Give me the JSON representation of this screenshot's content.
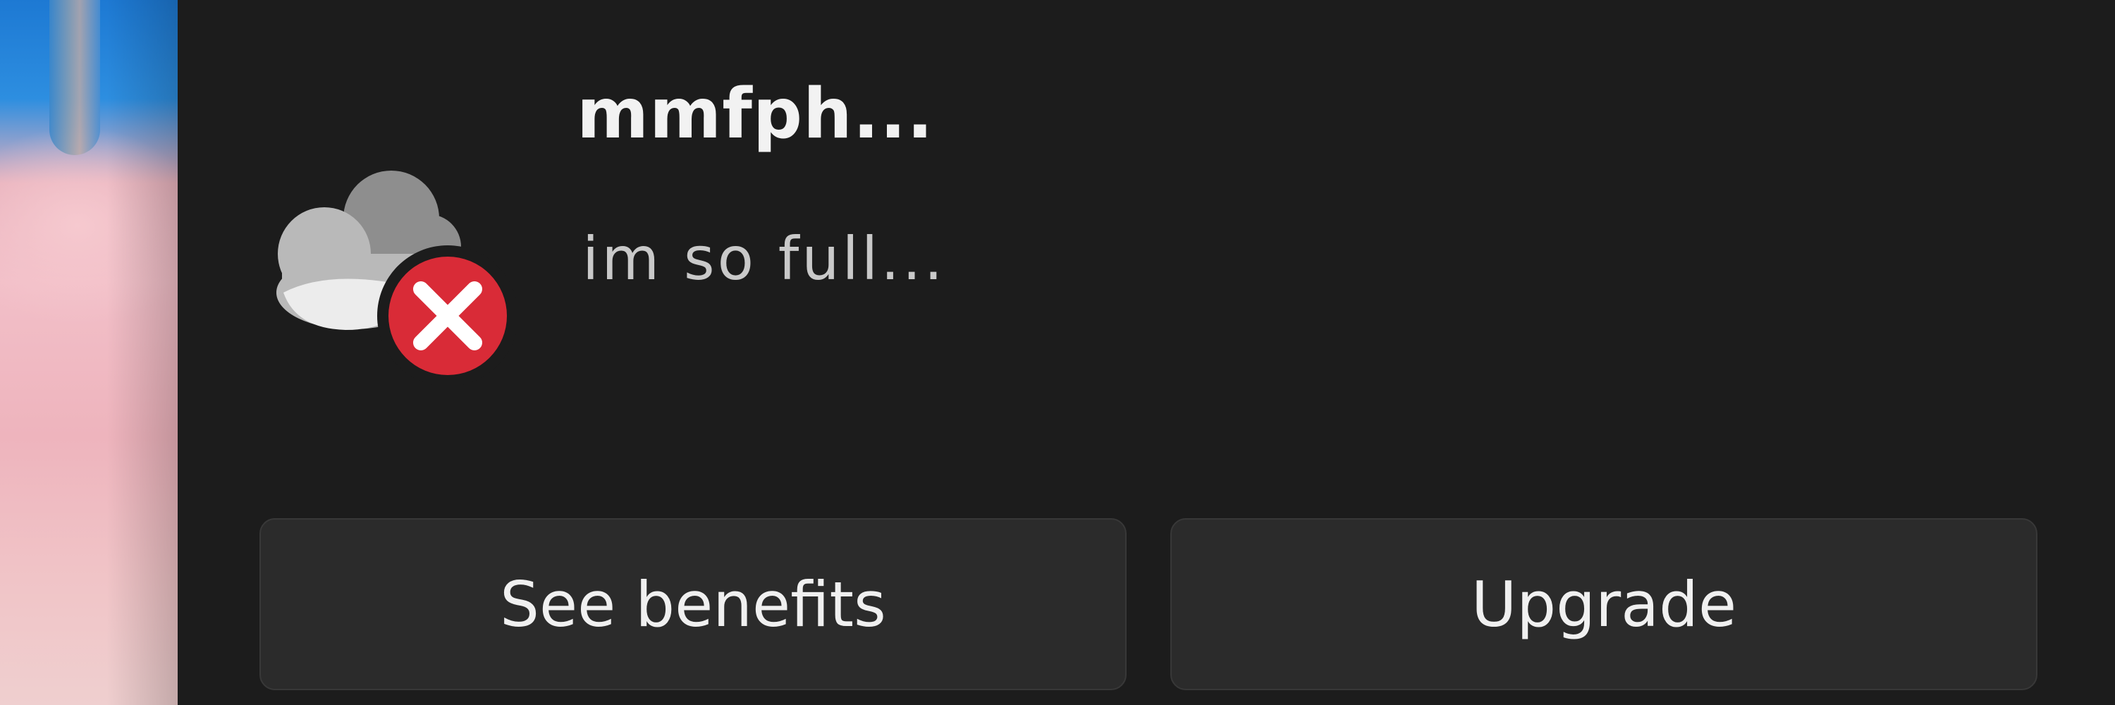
{
  "notification": {
    "title": "mmfph...",
    "message": "im so full...",
    "app_icon": "onedrive-cloud-icon",
    "status_icon": "error-x-icon",
    "status_color": "#d92b37"
  },
  "actions": {
    "see_benefits_label": "See benefits",
    "upgrade_label": "Upgrade"
  },
  "colors": {
    "background": "#1c1c1c",
    "button": "#2b2b2b",
    "text": "#f2f2f2"
  }
}
